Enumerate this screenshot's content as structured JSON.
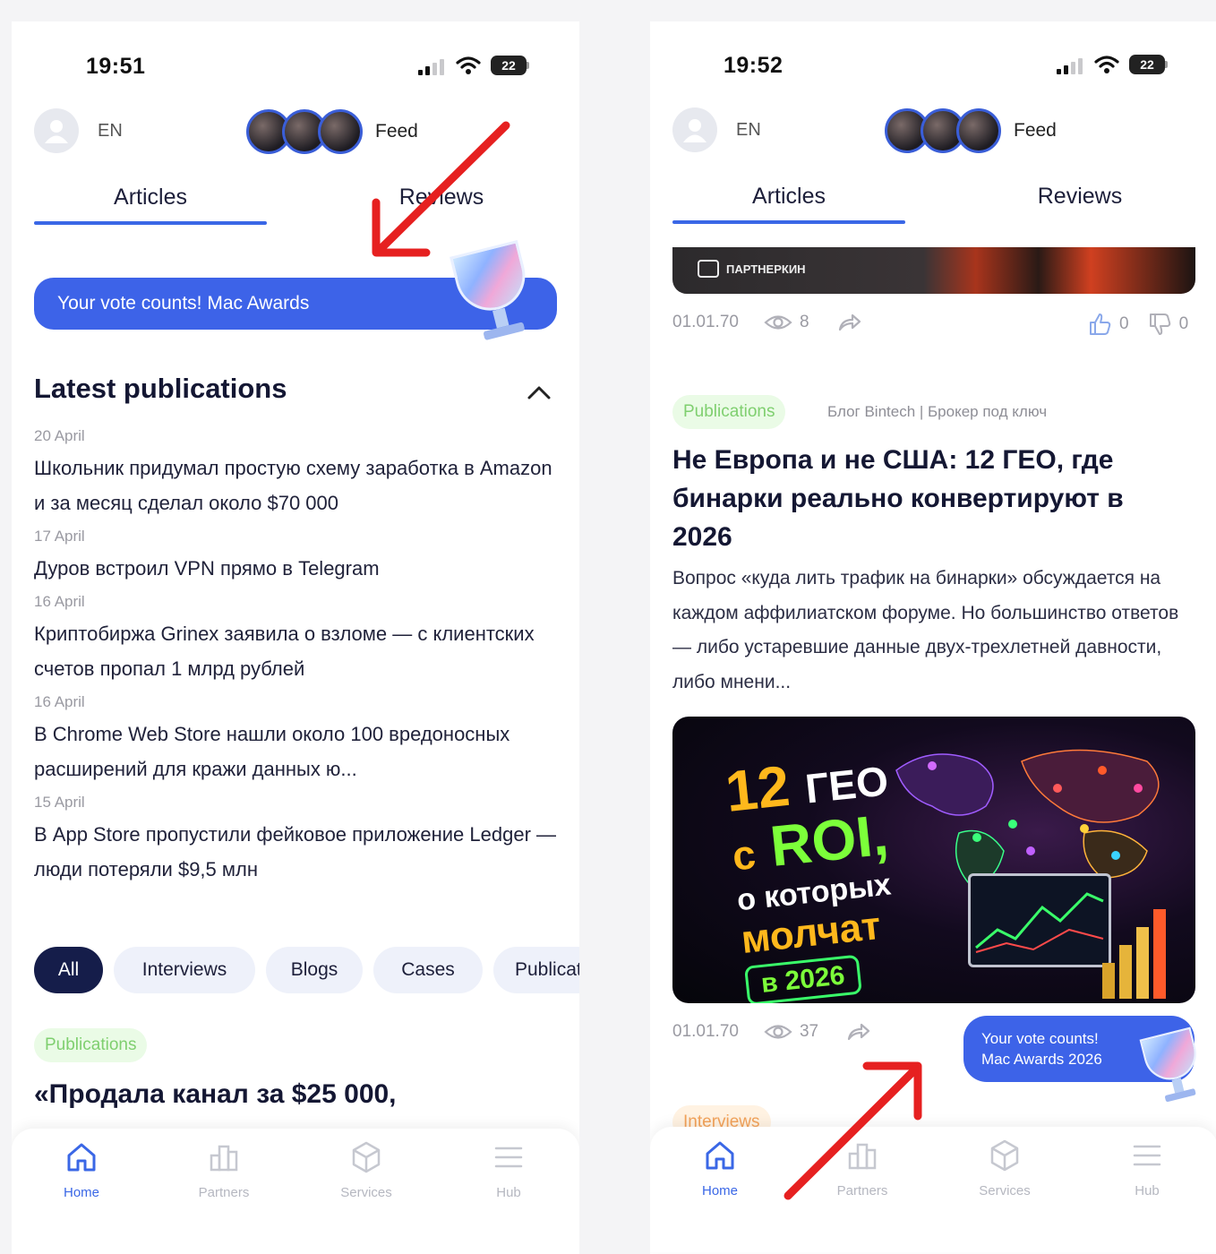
{
  "left": {
    "status": {
      "time": "19:51",
      "battery": "22"
    },
    "header": {
      "lang": "EN",
      "feed_label": "Feed"
    },
    "tabs": {
      "articles": "Articles",
      "reviews": "Reviews"
    },
    "banner": {
      "text": "Your vote counts! Mac Awards"
    },
    "latest": {
      "title": "Latest publications",
      "items": [
        {
          "date": "20 April",
          "title": "Школьник придумал простую схему заработка в Amazon и за месяц сделал около $70 000"
        },
        {
          "date": "17 April",
          "title": "Дуров встроил VPN прямо в Telegram"
        },
        {
          "date": "16 April",
          "title": "Криптобиржа Grinex заявила о взломе — с клиентских счетов пропал 1 млрд рублей"
        },
        {
          "date": "16 April",
          "title": "В Chrome Web Store нашли около 100 вредоносных расширений для кражи данных ю..."
        },
        {
          "date": "15 April",
          "title": "В App Store пропустили фейковое приложение Ledger — люди потеряли $9,5 млн"
        }
      ]
    },
    "chips": [
      "All",
      "Interviews",
      "Blogs",
      "Cases",
      "Publicat"
    ],
    "card": {
      "tag": "Publications",
      "title": "«Продала канал за $25 000,"
    }
  },
  "right": {
    "status": {
      "time": "19:52",
      "battery": "22"
    },
    "header": {
      "lang": "EN",
      "feed_label": "Feed"
    },
    "tabs": {
      "articles": "Articles",
      "reviews": "Reviews"
    },
    "top_image": {
      "brand": "ПАРТНЕРКИН"
    },
    "meta1": {
      "date": "01.01.70",
      "views": "8",
      "likes": "0",
      "dislikes": "0"
    },
    "card": {
      "tag": "Publications",
      "source": "Блог Bintech | Брокер под ключ",
      "title": "Не Европа и не США: 12 ГЕО, где бинарки реально конвертируют в 2026",
      "excerpt": "Вопрос «куда лить трафик на бинарки» обсуждается на каждом аффилиатском форуме. Но большинство ответов — либо устаревшие данные двух-трехлетней давности, либо мнени...",
      "image_text": {
        "line1_num": "12",
        "line1_word": "ГЕО",
        "line2_prefix": "с",
        "line2_word": "ROI,",
        "line3": "о которых",
        "line4": "молчат",
        "line5": "в 2026"
      }
    },
    "meta2": {
      "date": "01.01.70",
      "views": "37"
    },
    "float_banner": {
      "line1": "Your vote counts!",
      "line2": "Mac Awards 2026"
    },
    "next_tag": "Interviews"
  },
  "nav": {
    "home": "Home",
    "partners": "Partners",
    "services": "Services",
    "hub": "Hub"
  },
  "colors": {
    "accent": "#3a67e6",
    "banner": "#3d63e8",
    "dark_chip": "#151d4a",
    "arrow": "#e62020"
  }
}
